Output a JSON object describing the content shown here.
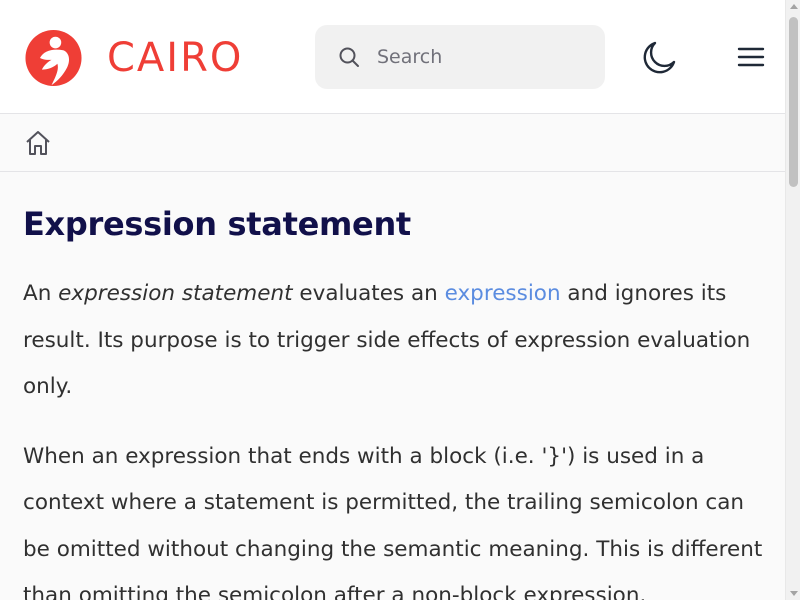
{
  "header": {
    "logo_text": "CAIRO",
    "brand_color": "#ef3e36",
    "search": {
      "placeholder": "Search",
      "value": ""
    },
    "theme_icon": "moon-icon",
    "menu_icon": "hamburger-menu-icon"
  },
  "breadcrumb": {
    "home_icon": "home-icon"
  },
  "main": {
    "title": "Expression statement",
    "para1": {
      "part1": "An ",
      "emphasis": "expression statement",
      "part2": " evaluates an ",
      "link": "expression",
      "part3": " and ignores its result. Its purpose is to trigger side effects of expression evaluation only."
    },
    "para2": "When an expression that ends with a block (i.e. '}') is used in a context where a statement is permitted, the trailing semicolon can be omitted without changing the semantic meaning. This is different than omitting the semicolon after a non-block expression."
  },
  "colors": {
    "title": "#11104a",
    "link": "#5b8ce0",
    "text": "#303030"
  }
}
